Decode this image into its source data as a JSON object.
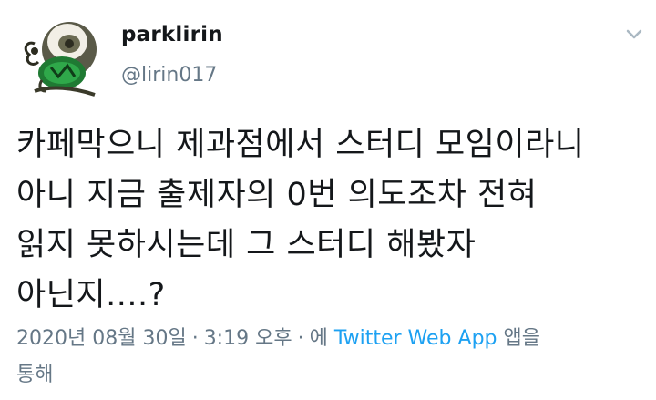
{
  "user": {
    "display_name": "parklirin",
    "handle": "@lirin017"
  },
  "tweet": {
    "lines": [
      "카페막으니 제과점에서 스터디 모임이라니",
      "아니 지금 출제자의 0번 의도조차 전혀",
      "읽지 못하시는데 그 스터디 해봤자",
      "아닌지....?"
    ]
  },
  "meta": {
    "date": "2020년 08월 30일",
    "separator": "·",
    "time": "3:19 오후",
    "via_prefix": "에",
    "source": "Twitter Web App",
    "via_suffix": "앱을",
    "via_suffix_2": "통해"
  },
  "icons": {
    "caret": "chevron-down-icon",
    "avatar": "avatar-image"
  },
  "colors": {
    "text": "#14171a",
    "muted": "#657786",
    "link": "#1da1f2"
  }
}
